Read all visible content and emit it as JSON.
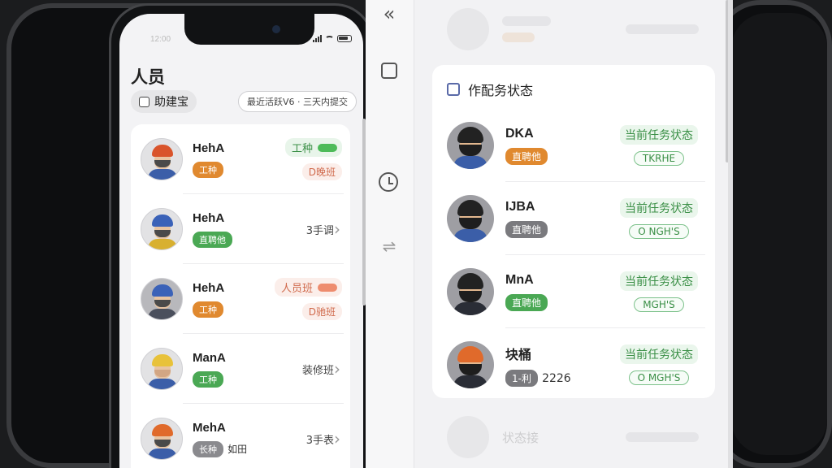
{
  "left_phone": {
    "status_time": "12:00",
    "title": "人员",
    "assistant_chip": "助建宝",
    "filter_pill": "最近活跃V6 · 三天内提交",
    "rows": [
      {
        "name": "HehA",
        "tag": "工种",
        "tag_color": "#e0892f",
        "status": "工种",
        "status_bg": "#e8f5ea",
        "status_color": "#3a8f46",
        "status_dot": "#4dbb59",
        "sub": "D晚班",
        "sub_color": "#d06a4c",
        "sub_bg": "#fbeeea",
        "meta": "",
        "helmet": "#d9542b",
        "body": "#3b5ea8"
      },
      {
        "name": "HehA",
        "tag": "直聘他",
        "tag_color": "#4aa854",
        "status": "",
        "meta": "3手调",
        "helmet": "#3b62b8",
        "body": "#d8b030"
      },
      {
        "name": "HehA",
        "tag": "工种",
        "tag_color": "#e0892f",
        "status": "人员班",
        "status_bg": "#fbeeea",
        "status_color": "#d06a4c",
        "status_dot": "#ee8c6e",
        "sub": "D驰班",
        "sub_color": "#d06a4c",
        "sub_bg": "#fbeeea",
        "meta": "",
        "helmet": "#3b62b8",
        "body": "#4a4f5c"
      },
      {
        "name": "ManA",
        "tag": "工种",
        "tag_color": "#4aa854",
        "status": "",
        "meta": "装修班",
        "helmet": "#e8c23a",
        "body": "#3b5ea8"
      },
      {
        "name": "MehA",
        "tag": "长种",
        "tag_color": "#8a8a8e",
        "tag_extra": "如田",
        "status": "",
        "meta": "3手表",
        "helmet": "#e06a2b",
        "body": "#3b5ea8"
      }
    ]
  },
  "toolbar": {
    "back_label": "«",
    "adjust_label": "⇌"
  },
  "right_panel": {
    "header": "作配务状态",
    "rows": [
      {
        "name": "DKA",
        "tag": "直聘他",
        "tag_color": "#e0892f",
        "status": "当前任务状态",
        "code": "TKRHE",
        "helmet": ""
      },
      {
        "name": "IJBA",
        "tag": "直聘他",
        "tag_color": "#7a7a7e",
        "status": "当前任务状态",
        "code": "O NGH'S",
        "helmet": ""
      },
      {
        "name": "MnA",
        "tag": "直聘他",
        "tag_color": "#4aa854",
        "status": "当前任务状态",
        "code": "MGH'S",
        "helmet": ""
      },
      {
        "name": "块桶",
        "tag": "1-利",
        "tag_color": "#7a7a7e",
        "tag_extra": "2226",
        "status": "当前任务状态",
        "code": "O MGH'S",
        "helmet": "#e06a2b"
      }
    ],
    "ghost_bottom": "状态接"
  }
}
